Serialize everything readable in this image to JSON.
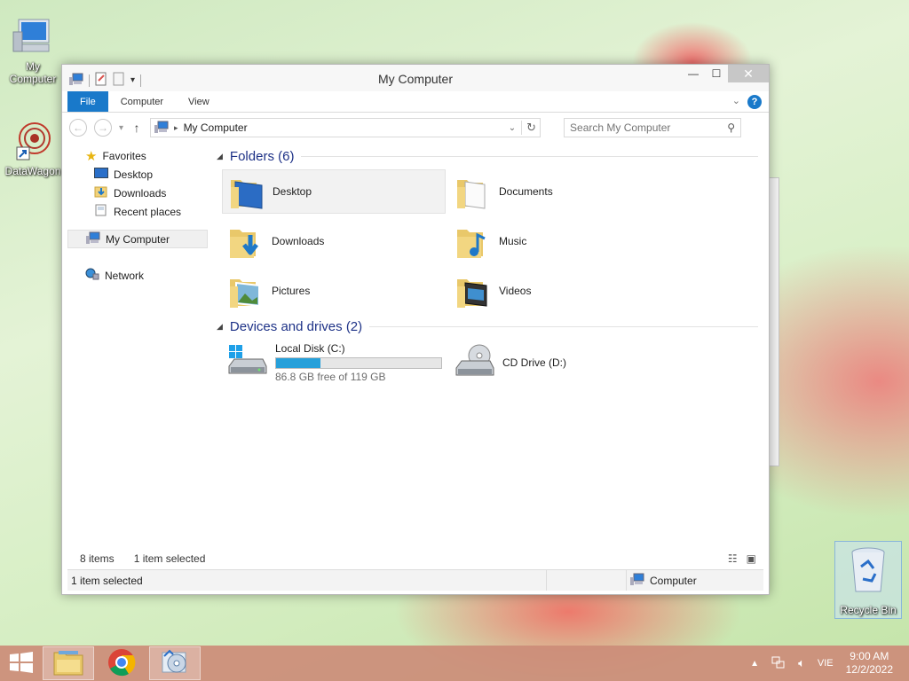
{
  "desktop": {
    "icons": [
      {
        "label": "My Computer"
      },
      {
        "label": "DataWagon"
      },
      {
        "label": "Recycle Bin"
      }
    ]
  },
  "window": {
    "title": "My Computer",
    "ribbon_tabs": [
      "File",
      "Computer",
      "View"
    ],
    "address": {
      "crumb": "My Computer"
    },
    "search": {
      "placeholder": "Search My Computer"
    },
    "nav": {
      "favorites": "Favorites",
      "desktop": "Desktop",
      "downloads": "Downloads",
      "recent": "Recent places",
      "mycomputer": "My Computer",
      "network": "Network"
    },
    "folders_header": "Folders (6)",
    "folders": [
      "Desktop",
      "Documents",
      "Downloads",
      "Music",
      "Pictures",
      "Videos"
    ],
    "devices_header": "Devices and drives (2)",
    "drives": [
      {
        "name": "Local Disk (C:)",
        "free": "86.8 GB free of 119 GB",
        "used_fraction": 0.27
      },
      {
        "name": "CD Drive (D:)"
      }
    ],
    "status": {
      "items": "8 items",
      "selected": "1 item selected"
    },
    "details": {
      "selected": "1 item selected",
      "location": "Computer"
    }
  },
  "taskbar": {
    "language": "VIE",
    "time": "9:00 AM",
    "date": "12/2/2022"
  },
  "colors": {
    "accent": "#1979ca",
    "drive_bar": "#26a0da",
    "group_header": "#1e3287"
  }
}
